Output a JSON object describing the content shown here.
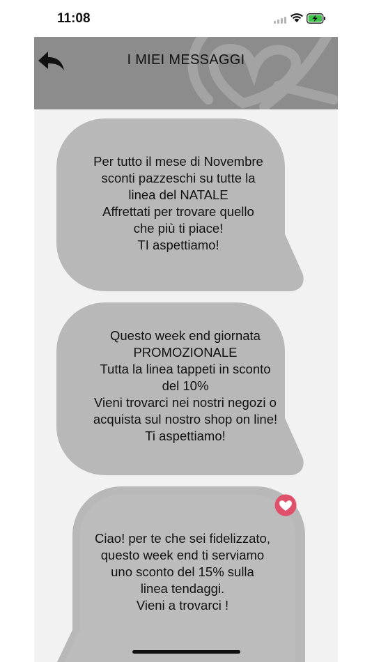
{
  "status_bar": {
    "time": "11:08"
  },
  "header": {
    "title": "I MIEI MESSAGGI"
  },
  "messages": [
    {
      "text": "Per tutto il mese di Novembre\nsconti pazzeschi su tutte la\nlinea del NATALE\nAffrettati per trovare quello\nche più ti piace!\nTI aspettiamo!",
      "favorite": false
    },
    {
      "text": "Questo week end giornata\nPROMOZIONALE\nTutta la linea tappeti in sconto\ndel 10%\nVieni trovarci nei nostri negozi o\nacquista sul nostro shop on line!\nTi aspettiamo!",
      "favorite": false
    },
    {
      "text": "Ciao! per te che sei fidelizzato,\nquesto week end ti serviamo\nuno sconto del 15% sulla\nlinea tendaggi.\nVieni a trovarci !",
      "favorite": true
    }
  ],
  "colors": {
    "header_bg": "#8c8c8c",
    "bubble_bg": "#b8b8b8",
    "page_bg": "#f2f2f2",
    "heart": "#e0506a"
  }
}
